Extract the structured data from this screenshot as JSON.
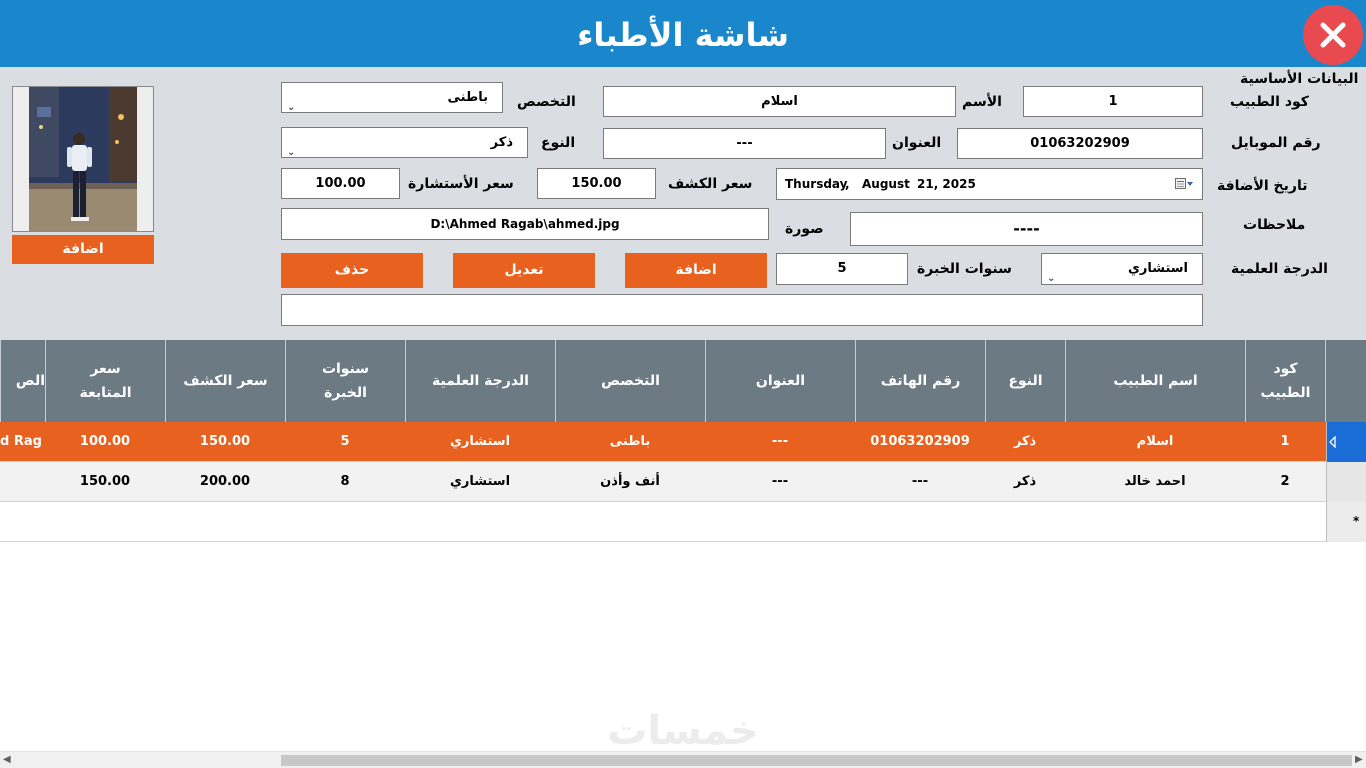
{
  "window": {
    "title": "شاشة الأطباء"
  },
  "form": {
    "section_title": "البيانات الأساسية",
    "doctor_code": {
      "label": "كود الطبيب",
      "value": "1"
    },
    "name": {
      "label": "الأسم",
      "value": "اسلام"
    },
    "specialty": {
      "label": "التخصص",
      "value": "باطنى"
    },
    "mobile": {
      "label": "رقم الموبايل",
      "value": "01063202909"
    },
    "address": {
      "label": "العنوان",
      "value": "---"
    },
    "gender": {
      "label": "النوع",
      "value": "ذكر"
    },
    "add_date": {
      "label": "تاريخ الأضافة",
      "weekday": "Thursday",
      "comma": ",",
      "month": "August",
      "day_year": "21, 2025"
    },
    "exam_price": {
      "label": "سعر الكشف",
      "value": "150.00"
    },
    "consult_price": {
      "label": "سعر الأستشارة",
      "value": "100.00"
    },
    "notes": {
      "label": "ملاحظات",
      "value": "----"
    },
    "image": {
      "label": "صورة",
      "path": "D:\\Ahmed Ragab\\ahmed.jpg"
    },
    "degree": {
      "label": "الدرجة العلمية",
      "value": "استشاري"
    },
    "experience": {
      "label": "سنوات الخبرة",
      "value": "5"
    },
    "buttons": {
      "add": "اضافة",
      "edit": "تعديل",
      "delete": "حذف",
      "add_photo": "اضافة"
    },
    "search_value": ""
  },
  "grid": {
    "columns": [
      {
        "line1": "كود",
        "line2": "الطبيب"
      },
      {
        "line1": "اسم الطبيب",
        "line2": ""
      },
      {
        "line1": "النوع",
        "line2": ""
      },
      {
        "line1": "رقم الهاتف",
        "line2": ""
      },
      {
        "line1": "العنوان",
        "line2": ""
      },
      {
        "line1": "التخصص",
        "line2": ""
      },
      {
        "line1": "الدرجة العلمية",
        "line2": ""
      },
      {
        "line1": "سنوات",
        "line2": "الخبرة"
      },
      {
        "line1": "سعر الكشف",
        "line2": ""
      },
      {
        "line1": "سعر",
        "line2": "المتابعة"
      },
      {
        "line1": "الص",
        "line2": ""
      }
    ],
    "rows": [
      {
        "code": "1",
        "name": "اسلام",
        "gender": "ذكر",
        "phone": "01063202909",
        "address": "---",
        "specialty": "باطنى",
        "degree": "استشاري",
        "experience": "5",
        "exam_price": "150.00",
        "followup_price": "100.00",
        "image": "d Rag"
      },
      {
        "code": "2",
        "name": "احمد خالد",
        "gender": "ذكر",
        "phone": "---",
        "address": "---",
        "specialty": "أنف وأذن",
        "degree": "استشاري",
        "experience": "8",
        "exam_price": "200.00",
        "followup_price": "150.00",
        "image": ""
      }
    ],
    "new_row_marker": "*"
  },
  "watermark": "خمسات",
  "colors": {
    "title_bar": "#1a87cc",
    "button": "#e8611e",
    "selected_row": "#e8611e",
    "grid_header": "#6c7a84",
    "close": "#e94a4f",
    "form_bg": "#dadde1"
  },
  "icons": {
    "close": "close-icon",
    "dropdown": "chevron-down-icon",
    "calendar": "calendar-icon",
    "row_pointer": "row-pointer-icon"
  }
}
